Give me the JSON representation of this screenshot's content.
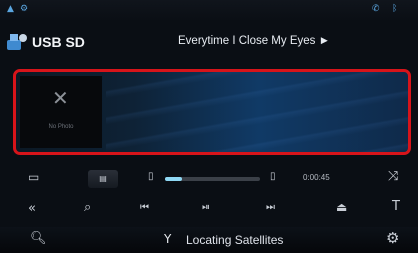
{
  "status_bar": {
    "left_icons": [
      "signal-icon",
      "settings-icon"
    ],
    "right_icons": [
      "phone-icon",
      "bluetooth-icon"
    ]
  },
  "header": {
    "source": "USB SD",
    "song_title": "Everytime I Close My Eyes",
    "song_more": "►"
  },
  "artwork": {
    "placeholder_text": "No Photo"
  },
  "player": {
    "progress": 0.18,
    "elapsed_time": "0:00:45"
  },
  "status": {
    "text": "Locating Satellites"
  },
  "colors": {
    "highlight": "#d7141a",
    "progress": "#8fd8f4",
    "accent": "#5aa6e0"
  }
}
